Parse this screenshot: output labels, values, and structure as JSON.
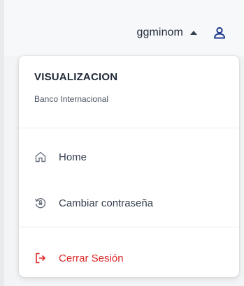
{
  "header": {
    "username": "ggminom",
    "user_icon": "user-icon",
    "caret_icon": "caret-up-icon"
  },
  "menu": {
    "role": "VISUALIZACION",
    "company": "Banco Internacional",
    "items": [
      {
        "label": "Home",
        "icon": "home-icon"
      },
      {
        "label": "Cambiar contraseña",
        "icon": "reset-password-icon"
      }
    ],
    "logout": {
      "label": "Cerrar Sesión",
      "icon": "logout-icon",
      "color": "#dc2626"
    }
  },
  "colors": {
    "accent": "#1f3a8a",
    "danger": "#dc2626"
  }
}
